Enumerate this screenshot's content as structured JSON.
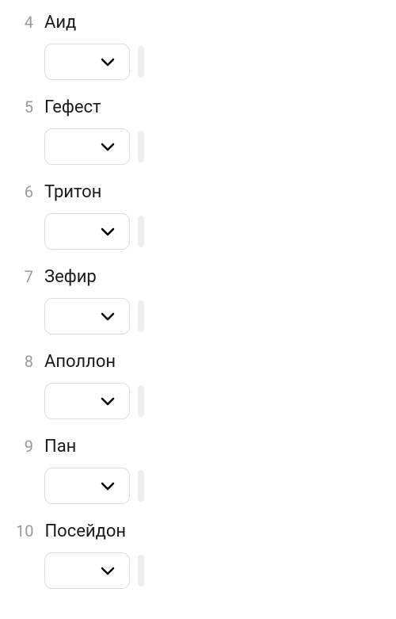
{
  "items": [
    {
      "number": "4",
      "label": "Аид"
    },
    {
      "number": "5",
      "label": "Гефест"
    },
    {
      "number": "6",
      "label": "Тритон"
    },
    {
      "number": "7",
      "label": "Зефир"
    },
    {
      "number": "8",
      "label": "Аполлон"
    },
    {
      "number": "9",
      "label": "Пан"
    },
    {
      "number": "10",
      "label": "Посейдон"
    }
  ]
}
